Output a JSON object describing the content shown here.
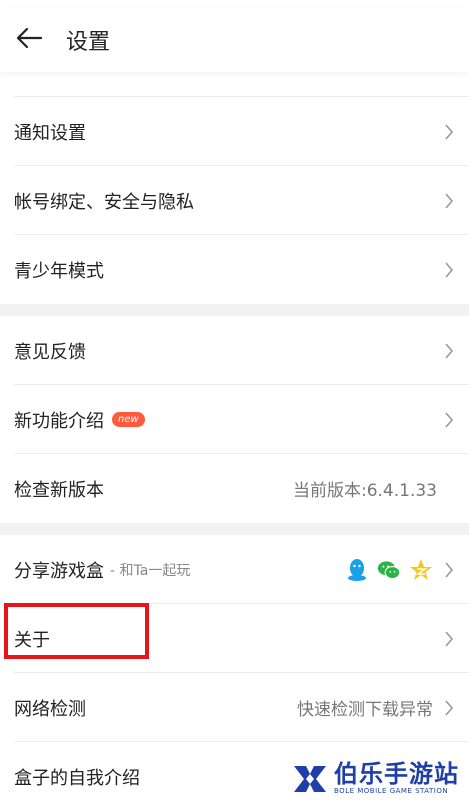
{
  "header": {
    "title": "设置"
  },
  "group1": [
    {
      "label": "通知设置"
    },
    {
      "label": "帐号绑定、安全与隐私"
    },
    {
      "label": "青少年模式"
    }
  ],
  "group2": [
    {
      "label": "意见反馈"
    },
    {
      "label": "新功能介绍",
      "badge": "new"
    },
    {
      "label": "检查新版本",
      "value": "当前版本:6.4.1.33"
    }
  ],
  "group3": [
    {
      "label": "分享游戏盒",
      "sub": "- 和Ta一起玩",
      "icons": [
        "qq-icon",
        "wechat-icon",
        "qzone-star-icon"
      ]
    },
    {
      "label": "关于"
    },
    {
      "label": "网络检测",
      "value": "快速检测下载异常"
    },
    {
      "label": "盒子的自我介绍"
    }
  ],
  "watermark": {
    "name": "伯乐手游站",
    "sub": "BOLE MOBILE GAME STATION"
  },
  "colors": {
    "badge": "#ff5a3c",
    "highlight": "#e8141b",
    "watermark": "#1f3ea8",
    "separator": "#f2f2f2"
  }
}
